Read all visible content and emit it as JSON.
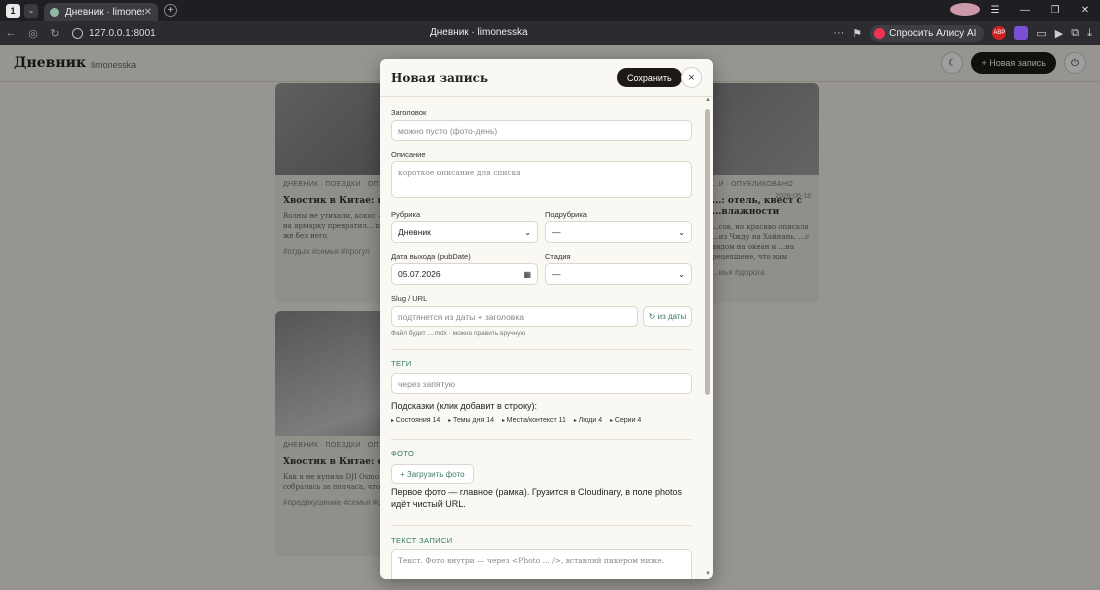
{
  "browser": {
    "tab_counter": "1",
    "tab_title": "Дневник · limonesska",
    "url": "127.0.0.1:8001",
    "page_title": "Дневник · limonesska",
    "alice_label": "Спросить Алису AI",
    "abp_label": "ABP"
  },
  "site": {
    "brand": "Дневник",
    "brand_sub": "limonesska",
    "new_entry_label": "+ Новая запись"
  },
  "cards": [
    {
      "meta": "ДНЕВНИК · ПОЕЗДКИ · ОПУБЛ",
      "title": "Хвостик в Китае: вол... ярмарка",
      "desc": "Волны не утихали, кокос — д... Xiaomi, оказывается — не то... поход на ярмарку превратил... пришёл лейтшку с джусем. Н... мало, куда же без него.",
      "tags": "#отдых  #семья  #прогул"
    },
    {
      "meta": "...И  · ОПУБЛИКОВАНО",
      "date": "2026-06-18",
      "title": "...: отель, квест с ...влажности",
      "desc": "...сов, но красиво описала ...из Чжду на Хайнань. ...с видом на океан и ...на рецепшене, что нам",
      "tags": "...мья  #дорога"
    },
    {
      "meta": "ДНЕВНИК · ПОЕЗДКИ · ОПУБЛ",
      "title": "Хвостик в Китае: сайт... сборы",
      "desc": "Как я не купила DJI Osmo Po... аренду, запустила сайт через... собралась за полчаса, чтобы... недели в режиме «ничего не...",
      "tags": "#предвкушение  #семья  #сбор"
    }
  ],
  "modal": {
    "title": "Новая запись",
    "save_label": "Сохранить",
    "close_icon": "×",
    "fields": {
      "title_label": "Заголовок",
      "title_placeholder": "можно пусто (фото-день)",
      "desc_label": "Описание",
      "desc_placeholder": "короткое описание для списка",
      "rubric_label": "Рубрика",
      "rubric_value": "Дневник",
      "subrubric_label": "Подрубрика",
      "subrubric_value": "—",
      "date_label": "Дата выхода (pubDate)",
      "date_value": "05.07.2026",
      "stage_label": "Стадия",
      "stage_value": "—",
      "slug_label": "Slug / URL",
      "slug_placeholder": "подтянется из даты + заголовка",
      "slug_button": "↻ из даты",
      "slug_hint": "Файл будет ....mdx · можно править вручную"
    },
    "tags_section": {
      "heading": "ТЕГИ",
      "placeholder": "через запятую",
      "hints_text": "Подсказки (клик добавит в строку):",
      "groups": [
        "Состояния 14",
        "Темы дня 14",
        "Места/контекст 11",
        "Люди 4",
        "Серии 4"
      ]
    },
    "photo_section": {
      "heading": "ФОТО",
      "upload_label": "+ Загрузить фото",
      "note": "Первое фото — главное (рамка). Грузится в Cloudinary, в поле photos идёт чистый URL."
    },
    "text_section": {
      "heading": "ТЕКСТ ЗАПИСИ",
      "placeholder": "Текст. Фото внутри — через <Photo ... />, вставляй пикером ниже."
    }
  }
}
